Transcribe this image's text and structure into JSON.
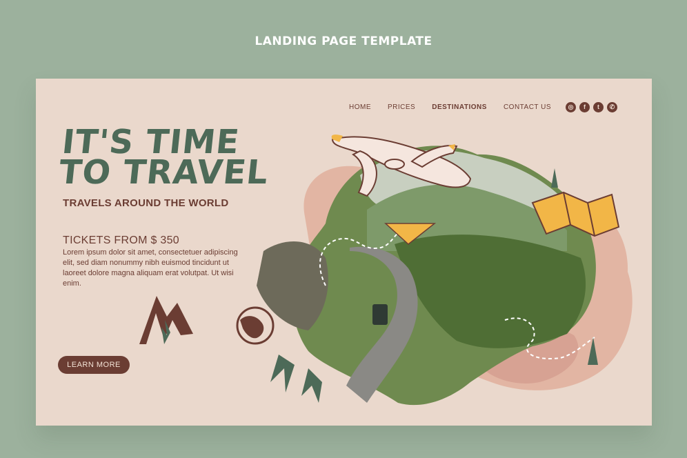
{
  "caption": "LANDING PAGE TEMPLATE",
  "nav": {
    "home": "HOME",
    "prices": "PRICES",
    "destinations": "DESTINATIONS",
    "contact": "CONTACT US"
  },
  "social": [
    "instagram-icon",
    "facebook-icon",
    "twitter-icon",
    "whatsapp-icon"
  ],
  "hero": {
    "title_line1": "IT'S TIME",
    "title_line2": "TO TRAVEL",
    "subtitle": "TRAVELS AROUND THE WORLD",
    "tickets": "TICKETS FROM $ 350",
    "body": "Lorem ipsum dolor sit amet, consectetuer adipiscing elit, sed diam nonummy nibh euismod tincidunt ut laoreet dolore magna aliquam erat volutpat. Ut wisi enim.",
    "cta": "LEARN MORE"
  },
  "colors": {
    "background": "#9cb19d",
    "card": "#ead8cc",
    "brown": "#6b3d33",
    "green": "#4d6a58",
    "accent": "#f2b647"
  }
}
